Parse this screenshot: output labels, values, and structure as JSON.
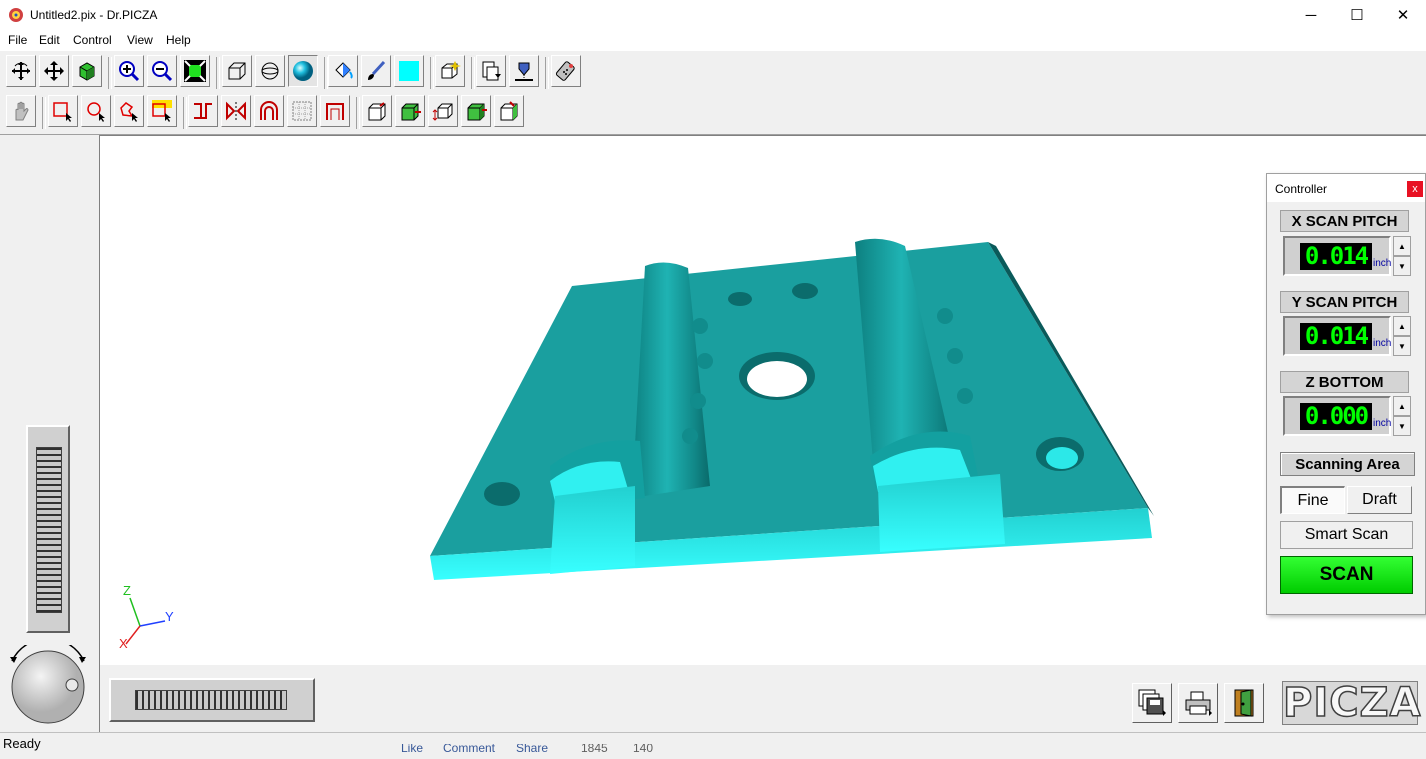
{
  "window": {
    "title": "Untitled2.pix - Dr.PICZA",
    "minimize": "─",
    "maximize": "☐",
    "close": "✕"
  },
  "menu": [
    "File",
    "Edit",
    "Control",
    "View",
    "Help"
  ],
  "toolbar_row1": [
    "rotate-icon",
    "move-icon",
    "cube-color-icon",
    "zoom-in-icon",
    "zoom-out-icon",
    "fit-view-icon",
    "wireframe-icon",
    "shaded-sphere-outline-icon",
    "shaded-sphere-icon",
    "paint-bucket-icon",
    "brush-icon",
    "color-swatch-icon",
    "multi-view-icon",
    "export-icon",
    "scan-height-icon",
    "remote-icon"
  ],
  "toolbar_row2": [
    "hand-icon",
    "rect-select-icon",
    "circle-select-icon",
    "lasso-select-icon",
    "scan-select-icon",
    "flip-h-icon",
    "mirror-icon",
    "arch-icon",
    "grid-icon",
    "crop-icon",
    "box-top-icon",
    "box-front-icon",
    "box-side-icon",
    "box-right-icon",
    "box-scale-icon"
  ],
  "controller": {
    "title": "Controller",
    "close": "x",
    "x_pitch": {
      "label": "X SCAN PITCH",
      "value": "0.014",
      "unit": "inch"
    },
    "y_pitch": {
      "label": "Y SCAN PITCH",
      "value": "0.014",
      "unit": "inch"
    },
    "z_bottom": {
      "label": "Z BOTTOM",
      "value": "0.000",
      "unit": "inch"
    },
    "scanning_area": "Scanning Area",
    "fine": "Fine",
    "draft": "Draft",
    "smart_scan": "Smart Scan",
    "scan": "SCAN"
  },
  "axes": {
    "z": "Z",
    "y": "Y",
    "x": "X"
  },
  "logo": "PICZA",
  "status": "Ready",
  "colors": {
    "model": "#1aa6a6",
    "model_highlight": "#2ef0f0",
    "scan_button": "#00dd00"
  },
  "social": {
    "like": "Like",
    "comment": "Comment",
    "share": "Share",
    "likes": "1845",
    "comments": "140"
  }
}
